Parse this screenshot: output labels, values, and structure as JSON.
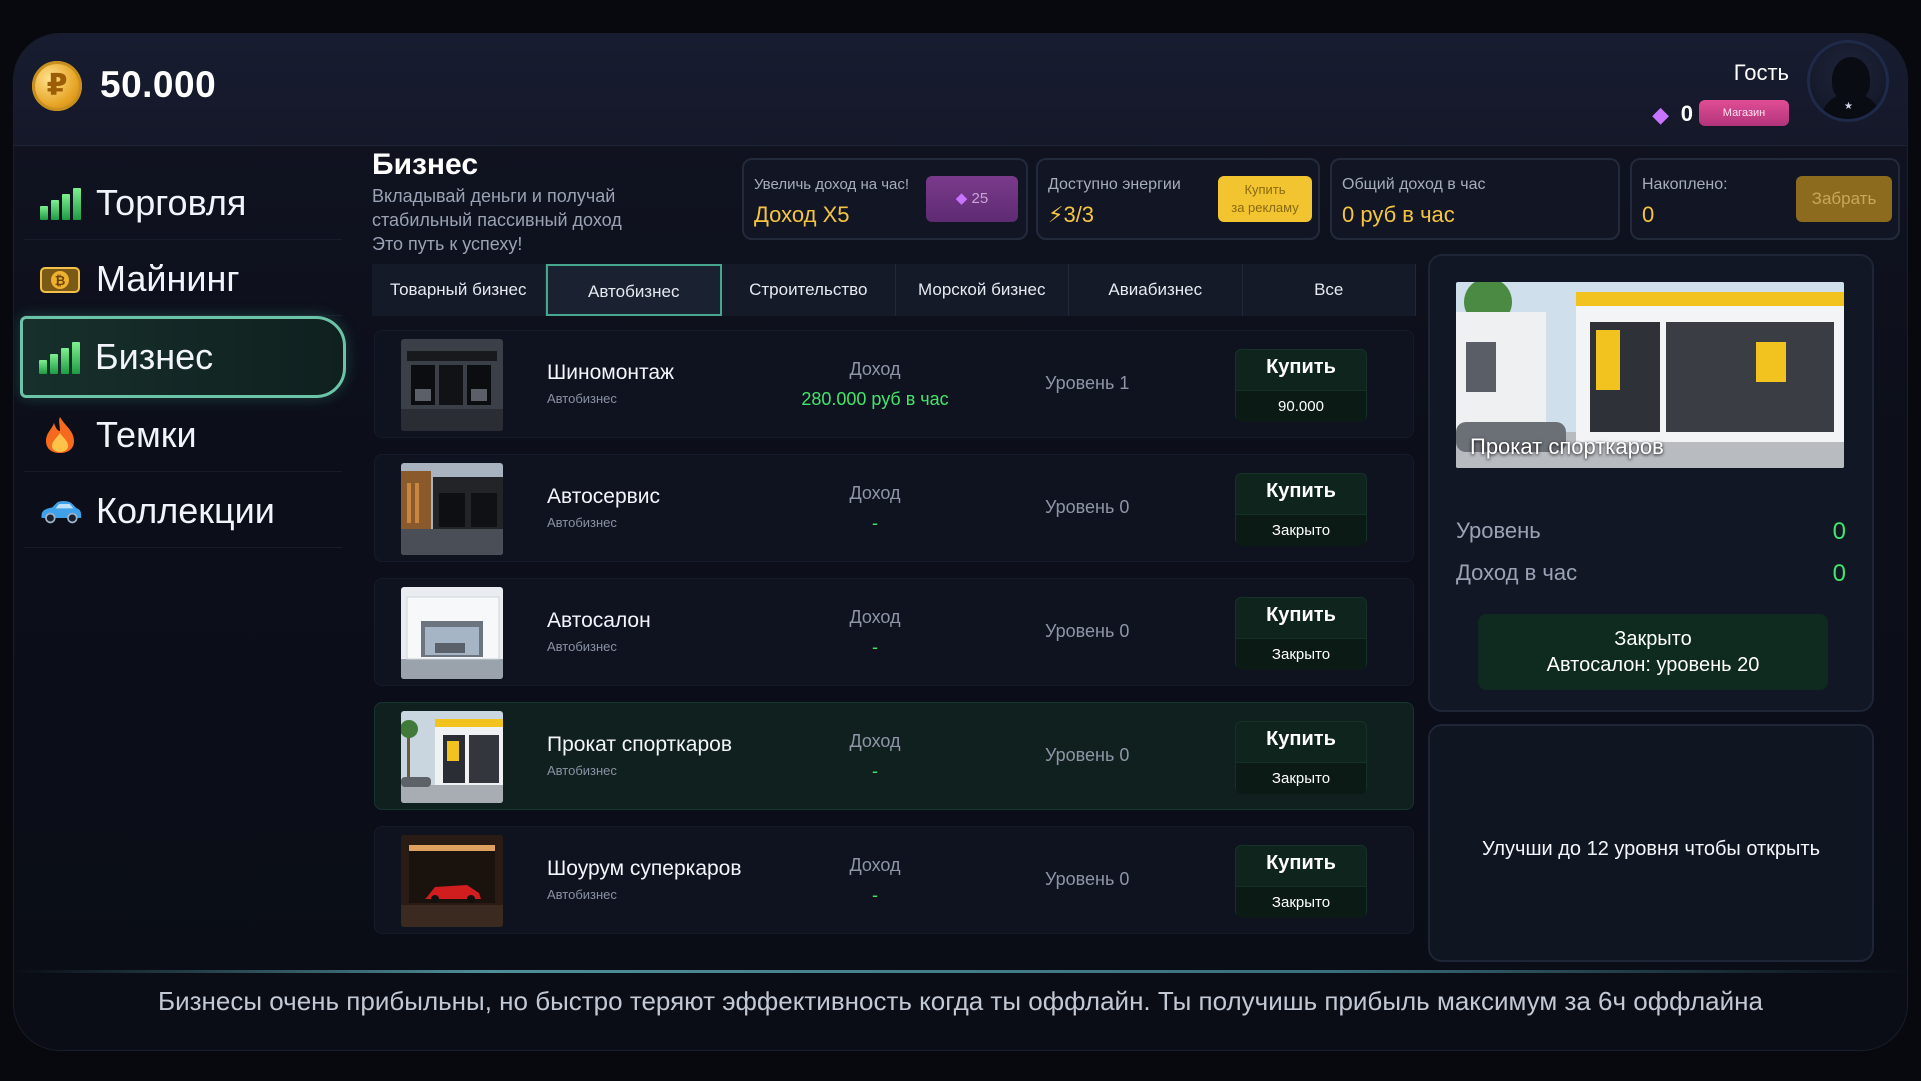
{
  "header": {
    "balance": "50.000",
    "coin_symbol": "₽",
    "username": "Гость",
    "gems": "0",
    "shop_label": "Магазин"
  },
  "sidebar": {
    "items": [
      {
        "label": "Торговля",
        "icon": "chart-bars-icon"
      },
      {
        "label": "Майнинг",
        "icon": "bitcoin-cash-icon"
      },
      {
        "label": "Бизнес",
        "icon": "chart-bars-icon",
        "active": true
      },
      {
        "label": "Темки",
        "icon": "fire-icon"
      },
      {
        "label": "Коллекции",
        "icon": "car-icon"
      }
    ]
  },
  "section": {
    "title": "Бизнес",
    "description": "Вкладывай деньги и получай стабильный пассивный доход Это путь к успеху!"
  },
  "stats": {
    "boost": {
      "caption": "Увеличь доход на час!",
      "value": "Доход X5",
      "button": "25"
    },
    "energy": {
      "caption": "Доступно энергии",
      "value": "3/3",
      "button_line1": "Купить",
      "button_line2": "за рекламу"
    },
    "income": {
      "caption": "Общий доход в час",
      "value": "0 руб в час"
    },
    "accumulated": {
      "caption": "Накоплено:",
      "value": "0",
      "button": "Забрать"
    }
  },
  "tabs": [
    {
      "label": "Товарный бизнес"
    },
    {
      "label": "Автобизнес",
      "active": true
    },
    {
      "label": "Строительство"
    },
    {
      "label": "Морской бизнес"
    },
    {
      "label": "Авиабизнес"
    },
    {
      "label": "Все"
    }
  ],
  "businesses": [
    {
      "name": "Шиномонтаж",
      "category": "Автобизнес",
      "income_caption": "Доход",
      "income": "280.000 руб в час",
      "level": "Уровень 1",
      "buy": "Купить",
      "price": "90.000"
    },
    {
      "name": "Автосервис",
      "category": "Автобизнес",
      "income_caption": "Доход",
      "income": "-",
      "level": "Уровень 0",
      "buy": "Купить",
      "price": "Закрыто"
    },
    {
      "name": "Автосалон",
      "category": "Автобизнес",
      "income_caption": "Доход",
      "income": "-",
      "level": "Уровень 0",
      "buy": "Купить",
      "price": "Закрыто"
    },
    {
      "name": "Прокат спорткаров",
      "category": "Автобизнес",
      "income_caption": "Доход",
      "income": "-",
      "level": "Уровень 0",
      "buy": "Купить",
      "price": "Закрыто",
      "highlighted": true
    },
    {
      "name": "Шоурум суперкаров",
      "category": "Автобизнес",
      "income_caption": "Доход",
      "income": "-",
      "level": "Уровень 0",
      "buy": "Купить",
      "price": "Закрыто"
    }
  ],
  "detail": {
    "title": "Прокат спорткаров",
    "level_label": "Уровень",
    "level_value": "0",
    "income_label": "Доход в час",
    "income_value": "0",
    "button_line1": "Закрыто",
    "button_line2": "Автосалон: уровень 20"
  },
  "locked_panel": {
    "message": "Улучши до 12 уровня чтобы открыть"
  },
  "footer": {
    "text": "Бизнесы очень прибыльны, но быстро теряют эффективность когда ты оффлайн. Ты получишь прибыль максимум за 6ч оффлайна"
  },
  "colors": {
    "accent_green": "#42e56a",
    "accent_gold": "#f5c542",
    "active_border": "#6cc4a8",
    "shop_pink": "#e04e95"
  }
}
